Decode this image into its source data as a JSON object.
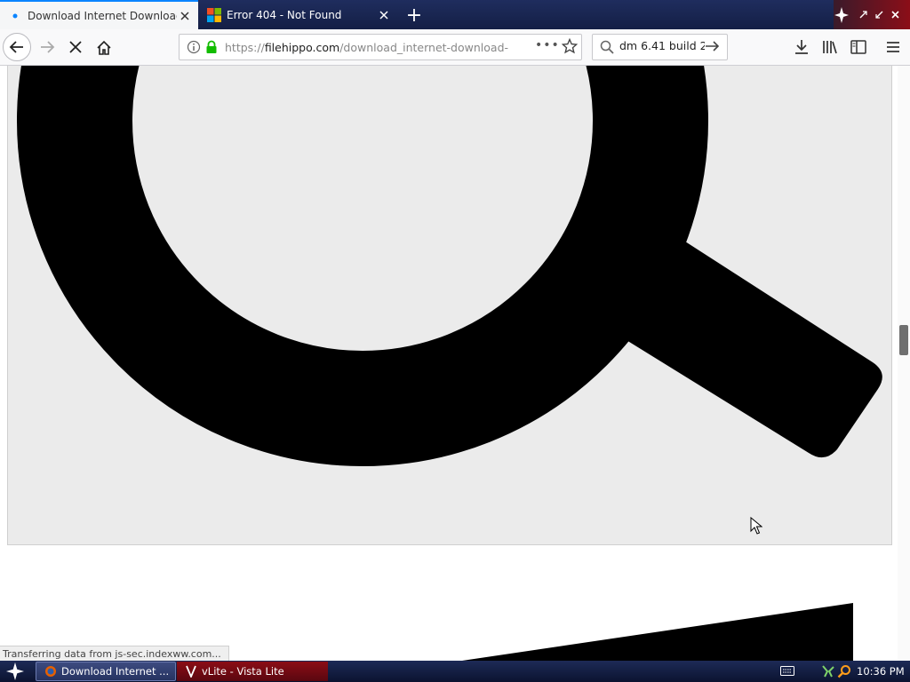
{
  "browser": {
    "tabs": [
      {
        "title": "Download Internet Download Manager",
        "favicon": "loading-dot-icon",
        "active": true
      },
      {
        "title": "Error 404 - Not Found",
        "favicon": "windows-logo-icon",
        "active": false
      }
    ],
    "new_tab_symbol": "+",
    "window_controls": [
      "minimize-icon",
      "maximize-icon",
      "close-icon"
    ],
    "nav": {
      "back": "back-arrow-icon",
      "forward": "forward-arrow-icon",
      "stop": "stop-x-icon",
      "home": "home-icon"
    },
    "url": {
      "scheme": "https://",
      "host": "filehippo.com",
      "path": "/download_internet-download-manager/",
      "more_symbol": "•••"
    },
    "search": {
      "value": "dm 6.41 build 2",
      "icon": "search-icon"
    },
    "toolbar_icons": [
      "downloads-icon",
      "library-icon",
      "sidebar-icon",
      "menu-icon"
    ]
  },
  "page": {
    "status_text": "Transferring data from js-sec.indexww.com..."
  },
  "taskbar": {
    "items": [
      {
        "label": "Download Internet ...",
        "icon": "firefox-icon"
      },
      {
        "label": "vLite - Vista Lite",
        "icon": "vlite-icon"
      }
    ],
    "clock": "10:36 PM"
  },
  "colors": {
    "accent": "#0a84ff",
    "tabbar": "#1f2d5e",
    "taskbar": "#0b1330",
    "lock_green": "#12bc00",
    "panel_bg": "#ebebeb"
  }
}
